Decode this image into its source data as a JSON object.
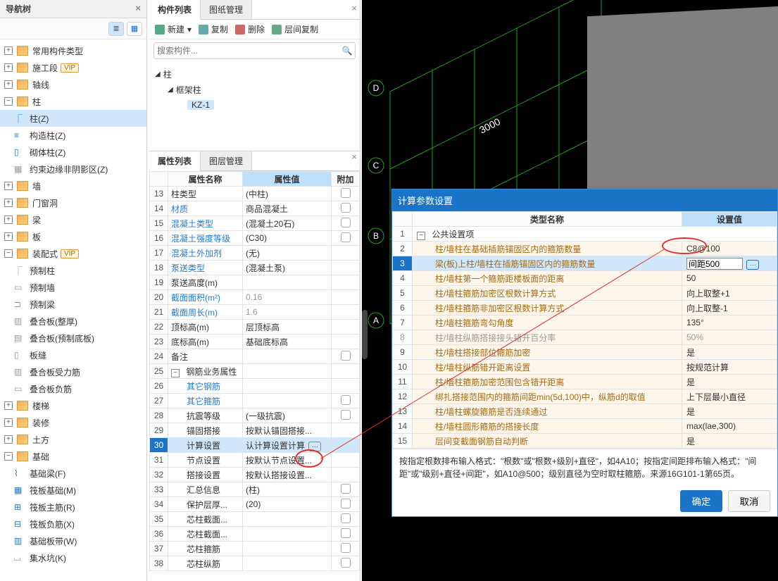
{
  "nav": {
    "title": "导航树",
    "items": [
      {
        "label": "常用构件类型",
        "lvl": 0,
        "tg": "+",
        "ico": "orange"
      },
      {
        "label": "施工段",
        "lvl": 0,
        "tg": "+",
        "ico": "orange",
        "vip": "VIP"
      },
      {
        "label": "轴线",
        "lvl": 0,
        "tg": "+",
        "ico": "orange"
      },
      {
        "label": "柱",
        "lvl": 0,
        "tg": "−",
        "ico": "orange"
      },
      {
        "label": "柱(Z)",
        "lvl": 1,
        "sel": true,
        "ico": "blue",
        "glyph": "⎾"
      },
      {
        "label": "构造柱(Z)",
        "lvl": 1,
        "ico": "blue",
        "glyph": "≡"
      },
      {
        "label": "砌体柱(Z)",
        "lvl": 1,
        "ico": "blue",
        "glyph": "▯"
      },
      {
        "label": "约束边缘非阴影区(Z)",
        "lvl": 1,
        "ico": "gray",
        "glyph": "▦"
      },
      {
        "label": "墙",
        "lvl": 0,
        "tg": "+",
        "ico": "orange"
      },
      {
        "label": "门窗洞",
        "lvl": 0,
        "tg": "+",
        "ico": "orange"
      },
      {
        "label": "梁",
        "lvl": 0,
        "tg": "+",
        "ico": "orange"
      },
      {
        "label": "板",
        "lvl": 0,
        "tg": "+",
        "ico": "orange"
      },
      {
        "label": "装配式",
        "lvl": 0,
        "tg": "−",
        "ico": "orange",
        "vip": "VIP"
      },
      {
        "label": "预制柱",
        "lvl": 1,
        "ico": "gray",
        "glyph": "⎾"
      },
      {
        "label": "预制墙",
        "lvl": 1,
        "ico": "gray",
        "glyph": "▭"
      },
      {
        "label": "预制梁",
        "lvl": 1,
        "ico": "gray",
        "glyph": "⊐"
      },
      {
        "label": "叠合板(整厚)",
        "lvl": 1,
        "ico": "gray",
        "glyph": "▥"
      },
      {
        "label": "叠合板(预制底板)",
        "lvl": 1,
        "ico": "gray",
        "glyph": "▤"
      },
      {
        "label": "板缝",
        "lvl": 1,
        "ico": "gray",
        "glyph": "▯"
      },
      {
        "label": "叠合板受力筋",
        "lvl": 1,
        "ico": "gray",
        "glyph": "▥"
      },
      {
        "label": "叠合板负筋",
        "lvl": 1,
        "ico": "gray",
        "glyph": "▭"
      },
      {
        "label": "楼梯",
        "lvl": 0,
        "tg": "+",
        "ico": "orange"
      },
      {
        "label": "装修",
        "lvl": 0,
        "tg": "+",
        "ico": "orange"
      },
      {
        "label": "土方",
        "lvl": 0,
        "tg": "+",
        "ico": "orange"
      },
      {
        "label": "基础",
        "lvl": 0,
        "tg": "−",
        "ico": "orange"
      },
      {
        "label": "基础梁(F)",
        "lvl": 1,
        "ico": "blue",
        "glyph": "⌇"
      },
      {
        "label": "筏板基础(M)",
        "lvl": 1,
        "ico": "blue",
        "glyph": "▦"
      },
      {
        "label": "筏板主筋(R)",
        "lvl": 1,
        "ico": "blue",
        "glyph": "⊞"
      },
      {
        "label": "筏板负筋(X)",
        "lvl": 1,
        "ico": "blue",
        "glyph": "⊟"
      },
      {
        "label": "基础板带(W)",
        "lvl": 1,
        "ico": "blue",
        "glyph": "▥"
      },
      {
        "label": "集水坑(K)",
        "lvl": 1,
        "ico": "blue",
        "glyph": "⌴"
      }
    ]
  },
  "mid": {
    "tabs": {
      "components": "构件列表",
      "drawings": "图纸管理"
    },
    "toolbar": {
      "new": "新建",
      "copy": "复制",
      "del": "删除",
      "layer": "层间复制"
    },
    "search_placeholder": "搜索构件...",
    "tree": {
      "root": "柱",
      "child": "框架柱",
      "leaf": "KZ-1"
    },
    "prop_tabs": {
      "props": "属性列表",
      "layers": "图层管理"
    },
    "headers": {
      "name": "属性名称",
      "value": "属性值",
      "add": "附加"
    },
    "rows": [
      {
        "i": 13,
        "n": "柱类型",
        "v": "(中柱)",
        "add": true
      },
      {
        "i": 14,
        "n": "材质",
        "v": "商品混凝土",
        "blue": true,
        "add": true
      },
      {
        "i": 15,
        "n": "混凝土类型",
        "v": "(混凝土20石)",
        "blue": true,
        "add": true
      },
      {
        "i": 16,
        "n": "混凝土强度等级",
        "v": "(C30)",
        "blue": true,
        "add": true
      },
      {
        "i": 17,
        "n": "混凝土外加剂",
        "v": "(无)",
        "blue": true
      },
      {
        "i": 18,
        "n": "泵送类型",
        "v": "(混凝土泵)",
        "blue": true
      },
      {
        "i": 19,
        "n": "泵送高度(m)",
        "v": ""
      },
      {
        "i": 20,
        "n": "截面面积(m²)",
        "v": "0.16",
        "blue": true,
        "gray": true
      },
      {
        "i": 21,
        "n": "截面周长(m)",
        "v": "1.6",
        "blue": true,
        "gray": true
      },
      {
        "i": 22,
        "n": "顶标高(m)",
        "v": "层顶标高"
      },
      {
        "i": 23,
        "n": "底标高(m)",
        "v": "基础底标高"
      },
      {
        "i": 24,
        "n": "备注",
        "v": "",
        "add": true
      },
      {
        "i": 25,
        "n": "钢筋业务属性",
        "v": "",
        "group": true,
        "tg": "−"
      },
      {
        "i": 26,
        "n": "其它钢筋",
        "v": "",
        "blue": true,
        "indent": 1
      },
      {
        "i": 27,
        "n": "其它箍筋",
        "v": "",
        "blue": true,
        "indent": 1,
        "add": true
      },
      {
        "i": 28,
        "n": "抗震等级",
        "v": "(一级抗震)",
        "indent": 1,
        "add": true
      },
      {
        "i": 29,
        "n": "锚固搭接",
        "v": "按默认锚固搭接...",
        "indent": 1
      },
      {
        "i": 30,
        "n": "计算设置",
        "v": "认计算设置计算",
        "sel": true,
        "indent": 1,
        "ell": true
      },
      {
        "i": 31,
        "n": "节点设置",
        "v": "按默认节点设置...",
        "indent": 1
      },
      {
        "i": 32,
        "n": "搭接设置",
        "v": "按默认搭接设置...",
        "indent": 1
      },
      {
        "i": 33,
        "n": "汇总信息",
        "v": "(柱)",
        "indent": 1,
        "add": true
      },
      {
        "i": 34,
        "n": "保护层厚...",
        "v": "(20)",
        "indent": 1,
        "add": true
      },
      {
        "i": 35,
        "n": "芯柱截面...",
        "v": "",
        "indent": 1,
        "add": true
      },
      {
        "i": 36,
        "n": "芯柱截面...",
        "v": "",
        "indent": 1,
        "add": true
      },
      {
        "i": 37,
        "n": "芯柱箍筋",
        "v": "",
        "indent": 1,
        "add": true
      },
      {
        "i": 38,
        "n": "芯柱纵筋",
        "v": "",
        "indent": 1,
        "add": true
      }
    ]
  },
  "drawing": {
    "axes": [
      "A",
      "B",
      "C",
      "D"
    ],
    "dim": "3000"
  },
  "calc": {
    "title": "计算参数设置",
    "headers": {
      "type": "类型名称",
      "set": "设置值"
    },
    "group": "公共设置项",
    "rows": [
      {
        "i": 2,
        "n": "柱/墙柱在基础插筋锚固区内的箍筋数量",
        "v": "C8@100"
      },
      {
        "i": 3,
        "n": "梁(板)上柱/墙柱在插筋锚固区内的箍筋数量",
        "v": "间距500",
        "sel": true,
        "input": true
      },
      {
        "i": 4,
        "n": "柱/墙柱第一个箍筋距楼板面的距离",
        "v": "50"
      },
      {
        "i": 5,
        "n": "柱/墙柱箍筋加密区根数计算方式",
        "v": "向上取整+1"
      },
      {
        "i": 6,
        "n": "柱/墙柱箍筋非加密区根数计算方式",
        "v": "向上取整-1"
      },
      {
        "i": 7,
        "n": "柱/墙柱箍筋弯勾角度",
        "v": "135°"
      },
      {
        "i": 8,
        "n": "柱/墙柱纵筋搭接接头错开百分率",
        "v": "50%",
        "dis": true
      },
      {
        "i": 9,
        "n": "柱/墙柱搭接部位箍筋加密",
        "v": "是"
      },
      {
        "i": 10,
        "n": "柱/墙柱纵筋错开距离设置",
        "v": "按规范计算"
      },
      {
        "i": 11,
        "n": "柱/墙柱箍筋加密范围包含错开距离",
        "v": "是"
      },
      {
        "i": 12,
        "n": "绑扎搭接范围内的箍筋间距min(5d,100)中，纵筋d的取值",
        "v": "上下层最小直径"
      },
      {
        "i": 13,
        "n": "柱/墙柱螺旋箍筋是否连续通过",
        "v": "是"
      },
      {
        "i": 14,
        "n": "柱/墙柱圆形箍筋的搭接长度",
        "v": "max(lae,300)"
      },
      {
        "i": 15,
        "n": "层间变截面钢筋自动判断",
        "v": "是"
      }
    ],
    "hint": "按指定根数排布输入格式：\"根数\"或\"根数+级别+直径\"，如4A10；按指定间距排布输入格式：\"间距\"或\"级别+直径+间距\"，如A10@500；级别直径为空时取柱箍筋。来源16G101-1第65页。",
    "ok": "确定",
    "cancel": "取消"
  }
}
